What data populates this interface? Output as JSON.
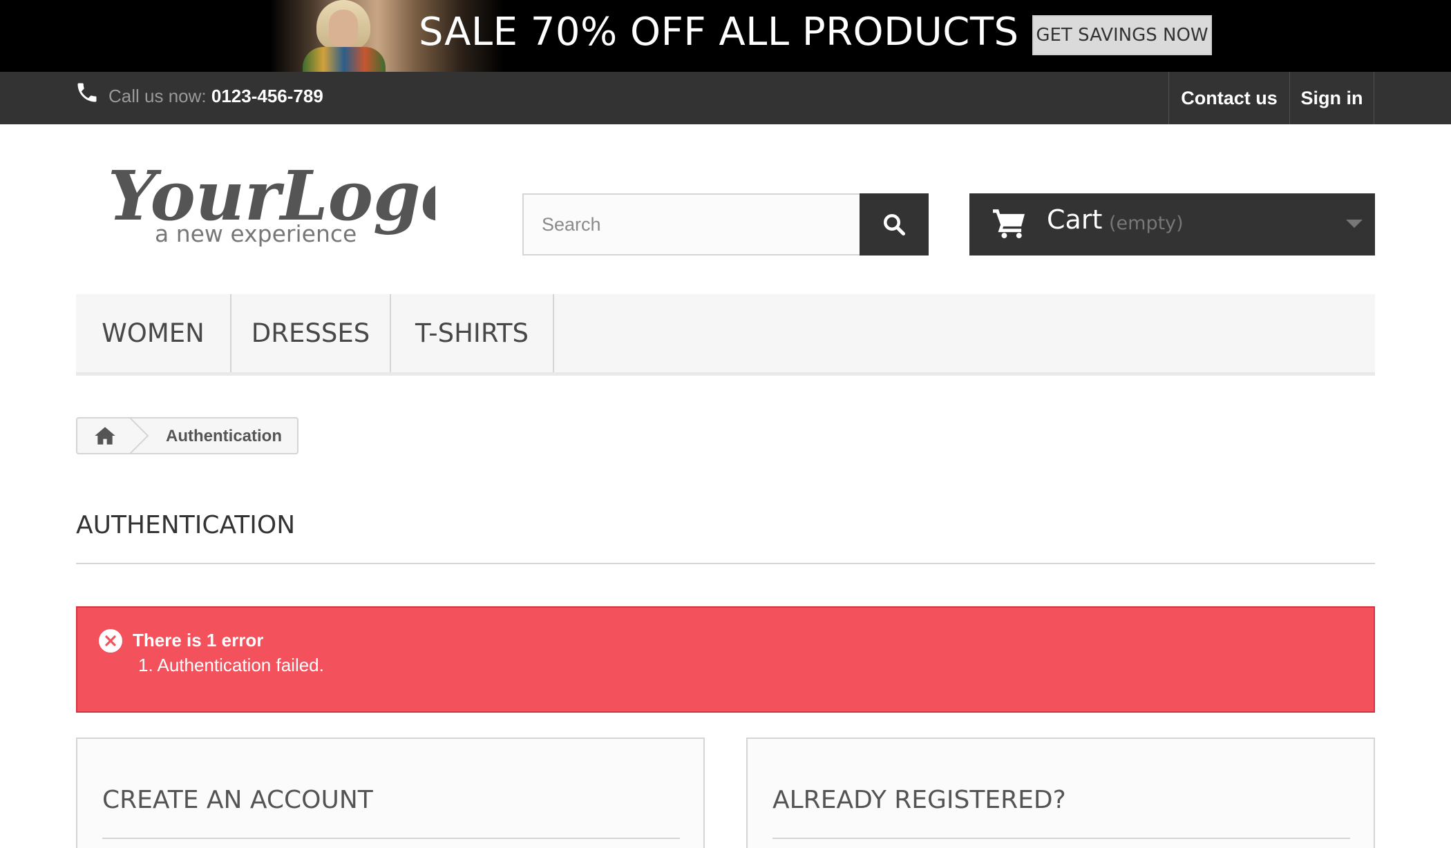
{
  "promo": {
    "headline": "SALE 70% OFF ALL PRODUCTS",
    "cta": "GET SAVINGS NOW"
  },
  "topbar": {
    "call_label": "Call us now:",
    "phone": "0123-456-789",
    "contact": "Contact us",
    "signin": "Sign in"
  },
  "header": {
    "logo_text": "YourLogo",
    "logo_tagline": "a new experience",
    "search_placeholder": "Search",
    "cart_label": "Cart",
    "cart_status": "(empty)"
  },
  "menu": {
    "items": [
      "WOMEN",
      "DRESSES",
      "T-SHIRTS"
    ]
  },
  "breadcrumb": {
    "current": "Authentication"
  },
  "page": {
    "title": "AUTHENTICATION"
  },
  "error": {
    "title": "There is 1 error",
    "items": [
      "1. Authentication failed."
    ]
  },
  "boxes": {
    "create": "CREATE AN ACCOUNT",
    "registered": "ALREADY REGISTERED?"
  },
  "colors": {
    "dark": "#333333",
    "error": "#f3515c",
    "menu_bg": "#f6f6f6",
    "border": "#d6d4d4"
  },
  "icons": [
    "phone-icon",
    "search-icon",
    "cart-icon",
    "chevron-down-icon",
    "home-icon",
    "error-icon"
  ]
}
